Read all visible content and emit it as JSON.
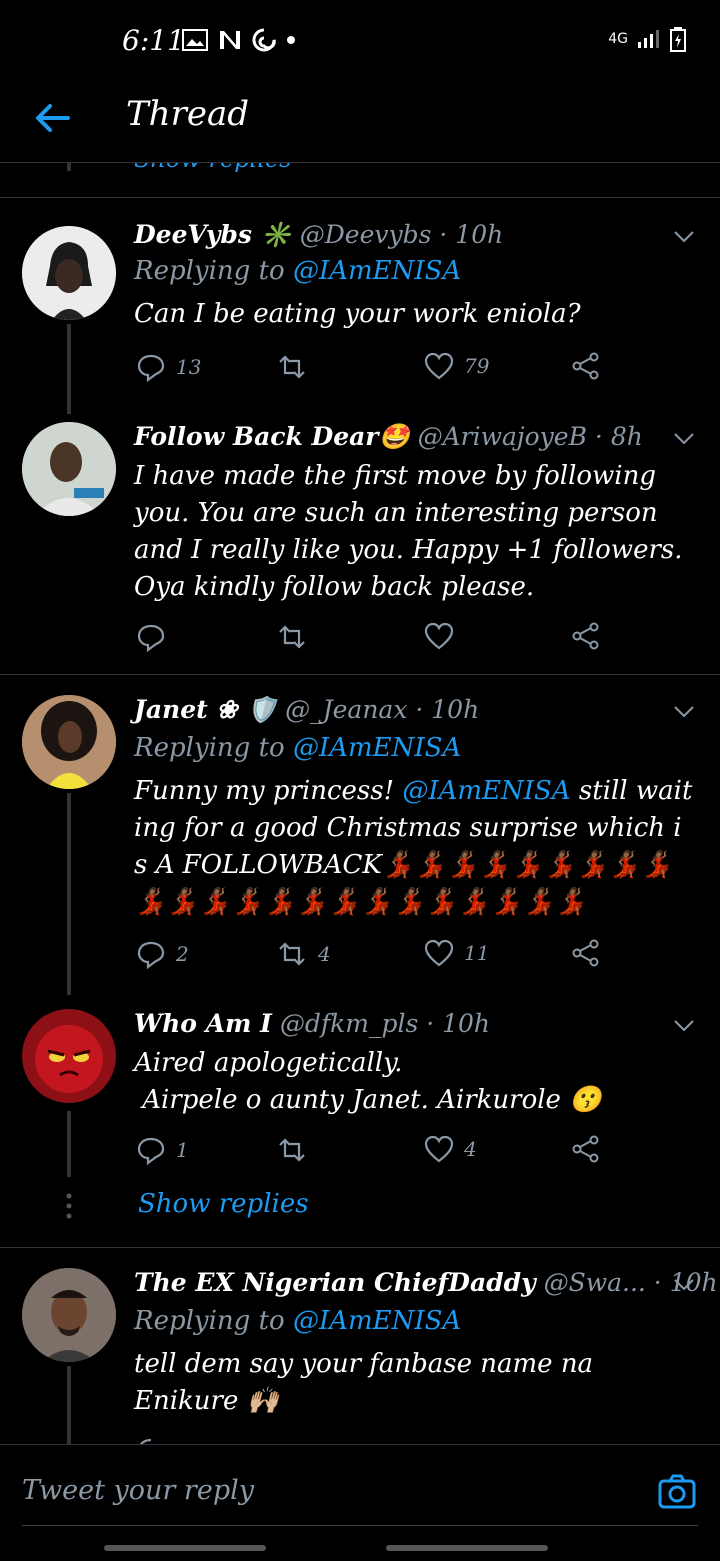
{
  "status": {
    "time": "6:11",
    "network": "4G"
  },
  "header": {
    "title": "Thread"
  },
  "peek": {
    "label": "Show replies"
  },
  "tweets": [
    {
      "name": "DeeVybs ✳️",
      "handle": "@Deevybs · 10h",
      "replying_prefix": "Replying to ",
      "replying_to": "@IAmENISA",
      "text": "Can I be eating your work eniola?",
      "replies": "13",
      "retweets": "",
      "likes": "79"
    },
    {
      "name": "Follow Back Dear🤩",
      "handle": "@AriwajoyeB · 8h",
      "text": "I have made the first move by following you. You are such an interesting person and I really like you. Happy +1 followers. Oya kindly follow back please.",
      "replies": "",
      "retweets": "",
      "likes": ""
    },
    {
      "name": "Janet ❀ 🛡️",
      "handle": "@_Jeanax · 10h",
      "replying_prefix": "Replying to ",
      "replying_to": "@IAmENISA",
      "text_a": "Funny my princess! ",
      "text_mention": "@IAmENISA",
      "text_b": " still waiting for a good Christmas surprise which is A FOLLOWBACK💃🏾💃🏾💃🏾💃🏾💃🏾💃🏾💃🏾💃🏾💃🏾💃🏾💃🏾💃🏾💃🏾💃🏾💃🏾💃🏾💃🏾💃🏾💃🏾💃🏾💃🏾💃🏾💃🏾",
      "replies": "2",
      "retweets": "4",
      "likes": "11"
    },
    {
      "name": "Who Am I",
      "handle": "@dfkm_pls · 10h",
      "text_line1": "Aired apologetically.",
      "text_line2": " Airpele o aunty Janet. Airkurole 😗",
      "replies": "1",
      "retweets": "",
      "likes": "4",
      "show_replies": "Show replies"
    },
    {
      "name": "The EX Nigerian ChiefDaddy",
      "handle": "@Swa... · 10h",
      "replying_prefix": "Replying to ",
      "replying_to": "@IAmENISA",
      "text": "tell dem say your fanbase name na Enikure 🙌🏼"
    }
  ],
  "composer": {
    "placeholder": "Tweet your reply"
  },
  "colors": {
    "accent": "#1d9bf0",
    "muted": "#8b98a5",
    "background": "#000000"
  }
}
